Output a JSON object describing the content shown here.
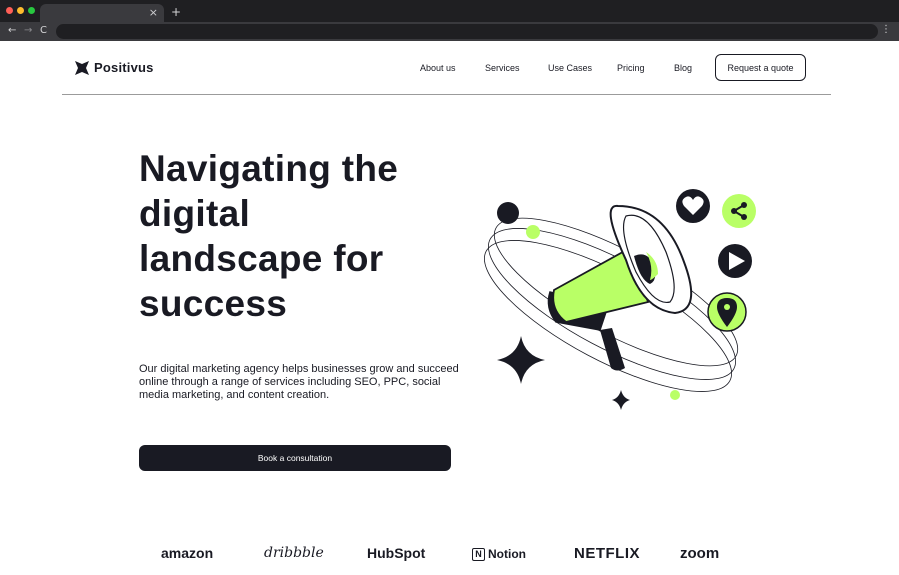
{
  "browser": {
    "tab_close": "×",
    "new_tab": "+",
    "back": "←",
    "forward": "→",
    "reload": "C",
    "menu": "⋮",
    "colors": {
      "close": "#ff5f57",
      "minimize": "#febc2e",
      "maximize": "#28c840"
    }
  },
  "header": {
    "logo_text": "Positivus",
    "nav": [
      "About us",
      "Services",
      "Use Cases",
      "Pricing",
      "Blog"
    ],
    "quote_button": "Request a quote"
  },
  "hero": {
    "title_lines": [
      "Navigating the",
      "digital",
      "landscape for",
      "success"
    ],
    "description": "Our digital marketing agency helps businesses grow and succeed online through a range of services including SEO, PPC, social media marketing, and content creation.",
    "cta": "Book a consultation",
    "accent_color": "#b9ff66",
    "dark_color": "#191a23",
    "illustration_icons": [
      "megaphone-icon",
      "heart-icon",
      "share-icon",
      "play-icon",
      "location-pin-icon",
      "sparkle-icon"
    ]
  },
  "brands": [
    "amazon",
    "dribbble",
    "HubSpot",
    "Notion",
    "NETFLIX",
    "zoom"
  ]
}
